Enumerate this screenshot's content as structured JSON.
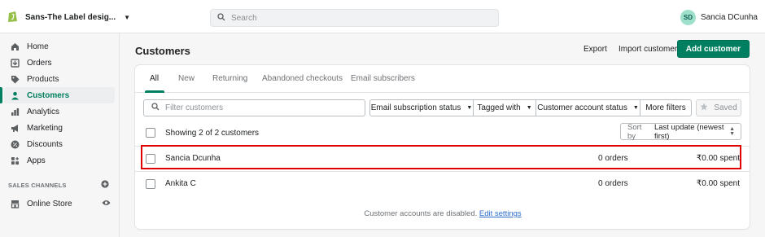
{
  "topbar": {
    "store_name": "Sans-The Label desig...",
    "search_placeholder": "Search",
    "user_initials": "SD",
    "user_name": "Sancia DCunha"
  },
  "sidebar": {
    "items": [
      {
        "label": "Home",
        "icon": "home-icon"
      },
      {
        "label": "Orders",
        "icon": "orders-icon"
      },
      {
        "label": "Products",
        "icon": "tag-icon"
      },
      {
        "label": "Customers",
        "icon": "person-icon",
        "active": true
      },
      {
        "label": "Analytics",
        "icon": "bar-chart-icon"
      },
      {
        "label": "Marketing",
        "icon": "megaphone-icon"
      },
      {
        "label": "Discounts",
        "icon": "discount-icon"
      },
      {
        "label": "Apps",
        "icon": "apps-icon"
      }
    ],
    "sales_channels_label": "SALES CHANNELS",
    "online_store_label": "Online Store"
  },
  "page": {
    "title": "Customers",
    "export_label": "Export",
    "import_label": "Import customers",
    "add_label": "Add customer"
  },
  "tabs": [
    "All",
    "New",
    "Returning",
    "Abandoned checkouts",
    "Email subscribers"
  ],
  "filters": {
    "search_placeholder": "Filter customers",
    "email_status": "Email subscription status",
    "tagged_with": "Tagged with",
    "account_status": "Customer account status",
    "more_filters": "More filters",
    "saved": "Saved"
  },
  "list": {
    "showing": "Showing 2 of 2 customers",
    "sort_prefix": "Sort by",
    "sort_value": "Last update (newest first)",
    "rows": [
      {
        "name": "Sancia Dcunha",
        "orders": "0 orders",
        "spent": "₹0.00 spent"
      },
      {
        "name": "Ankita C",
        "orders": "0 orders",
        "spent": "₹0.00 spent"
      }
    ]
  },
  "footer": {
    "note": "Customer accounts are disabled.",
    "link": "Edit settings"
  },
  "colors": {
    "brand_green": "#008060",
    "highlight_red": "#e00000",
    "link_blue": "#2c6ecb"
  }
}
